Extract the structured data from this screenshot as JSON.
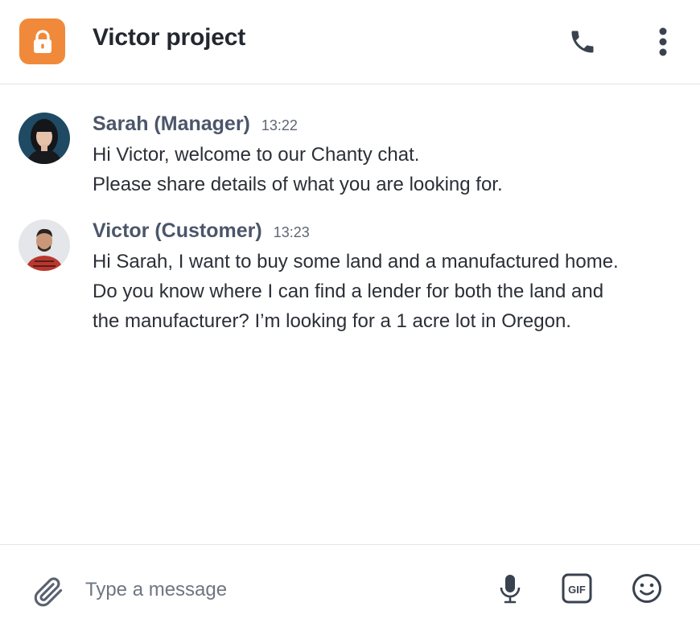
{
  "header": {
    "title": "Victor project",
    "channel_icon": "lock-icon",
    "call_icon": "phone-icon",
    "menu_icon": "more-vertical-icon",
    "accent_color": "#f08a3a"
  },
  "messages": [
    {
      "author": "Sarah (Manager)",
      "time": "13:22",
      "lines": [
        "Hi Victor, welcome to our Chanty chat.",
        "Please share details of what you are looking for."
      ]
    },
    {
      "author": "Victor (Customer)",
      "time": "13:23",
      "lines": [
        "Hi Sarah, I want to buy some land and a manufactured home.",
        "Do you know where I can find a lender for both the land and",
        "the manufacturer? I’m looking for a 1 acre lot in Oregon."
      ]
    }
  ],
  "composer": {
    "placeholder": "Type a message",
    "value": "",
    "attach_icon": "paperclip-icon",
    "mic_icon": "microphone-icon",
    "gif_label": "GIF",
    "emoji_icon": "smiley-icon"
  }
}
